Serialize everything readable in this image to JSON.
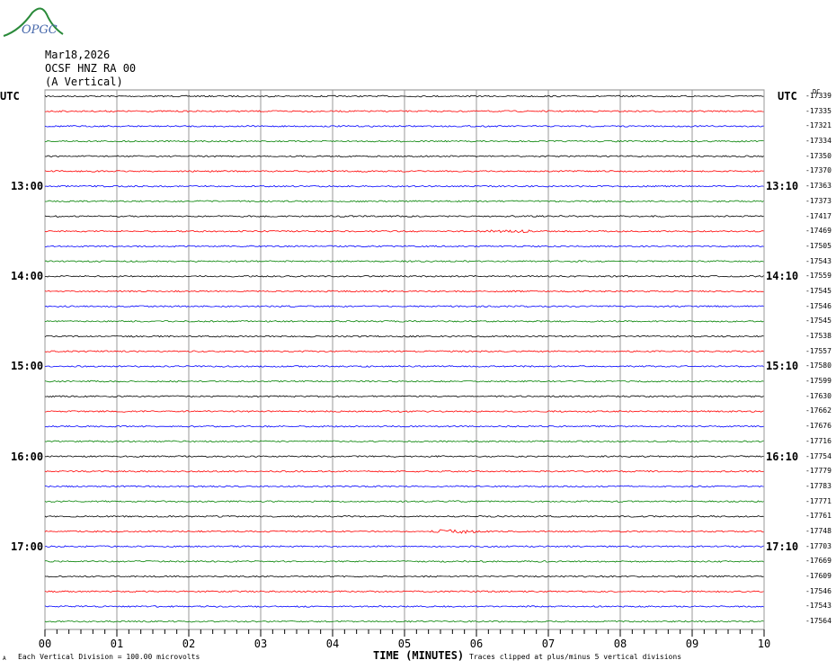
{
  "logo": {
    "text": "OPGC"
  },
  "header": {
    "date": "Mar18,2026",
    "station": "OCSF HNZ RA 00",
    "component": "(A Vertical)"
  },
  "colors": [
    "#000000",
    "#ff0000",
    "#0000ff",
    "#008000"
  ],
  "chart_data": {
    "type": "line",
    "title": "OCSF HNZ RA 00 (A Vertical) Mar18,2026",
    "xlabel": "TIME (MINUTES)",
    "xlim": [
      0,
      10
    ],
    "x_ticks": [
      "00",
      "01",
      "02",
      "03",
      "04",
      "05",
      "06",
      "07",
      "08",
      "09",
      "10"
    ],
    "left_labels": [
      "UTC",
      "13:00",
      "14:00",
      "15:00",
      "16:00",
      "17:00"
    ],
    "right_labels": [
      "UTC",
      "13:10",
      "14:10",
      "15:10",
      "16:10",
      "17:10"
    ],
    "offset_header": "DC",
    "trace_offsets": [
      -17339,
      -17335,
      -17321,
      -17334,
      -17350,
      -17370,
      -17363,
      -17373,
      -17417,
      -17469,
      -17505,
      -17543,
      -17559,
      -17545,
      -17546,
      -17545,
      -17538,
      -17557,
      -17580,
      -17599,
      -17630,
      -17662,
      -17676,
      -17716,
      -17754,
      -17779,
      -17783,
      -17771,
      -17761,
      -17748,
      -17703,
      -17669,
      -17609,
      -17546,
      -17543,
      -17564
    ],
    "minutes_per_trace": 10
  },
  "footer": {
    "scale": "Each Vertical Division =  100.00 microvolts",
    "clip": "Traces clipped at plus/minus 5 vertical divisions",
    "corner": "A"
  }
}
